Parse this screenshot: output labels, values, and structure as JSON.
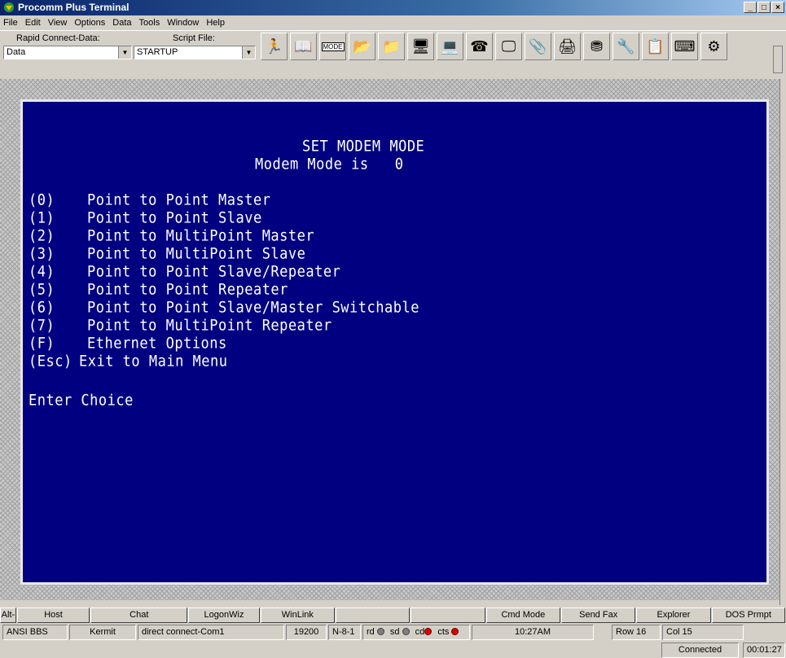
{
  "window": {
    "title": "Procomm Plus Terminal"
  },
  "menu": [
    "File",
    "Edit",
    "View",
    "Options",
    "Data",
    "Tools",
    "Window",
    "Help"
  ],
  "toolbar": {
    "rapid_label": "Rapid Connect-Data:",
    "rapid_value": "Data",
    "script_label": "Script File:",
    "script_value": "STARTUP",
    "mode_icon_text": "MODE"
  },
  "terminal": {
    "title": "SET MODEM MODE",
    "mode_line": "Modem Mode is   0",
    "options": [
      {
        "key": "(0)",
        "label": "Point to Point Master"
      },
      {
        "key": "(1)",
        "label": "Point to Point Slave"
      },
      {
        "key": "(2)",
        "label": "Point to MultiPoint Master"
      },
      {
        "key": "(3)",
        "label": "Point to MultiPoint Slave"
      },
      {
        "key": "(4)",
        "label": "Point to Point Slave/Repeater"
      },
      {
        "key": "(5)",
        "label": "Point to Point Repeater"
      },
      {
        "key": "(6)",
        "label": "Point to Point Slave/Master Switchable"
      },
      {
        "key": "(7)",
        "label": "Point to MultiPoint Repeater"
      },
      {
        "key": "(F)",
        "label": "Ethernet Options"
      },
      {
        "key": "(Esc)",
        "label": "Exit to Main Menu"
      }
    ],
    "prompt": "Enter Choice"
  },
  "buttons": [
    "Alt-",
    "Host",
    "Chat",
    "LogonWiz",
    "WinLink",
    "",
    "",
    "Cmd Mode",
    "Send Fax",
    "Explorer",
    "DOS Prmpt"
  ],
  "status": {
    "emulation": "ANSI BBS",
    "protocol": "Kermit",
    "connection": "direct connect-Com1",
    "baud": "19200",
    "params": "N-8-1",
    "rd": "rd",
    "sd": "sd",
    "cd": "cd",
    "cts": "cts",
    "time": "10:27AM",
    "row": "Row 16",
    "col": "Col 15",
    "connected": "Connected",
    "elapsed": "00:01:27"
  }
}
